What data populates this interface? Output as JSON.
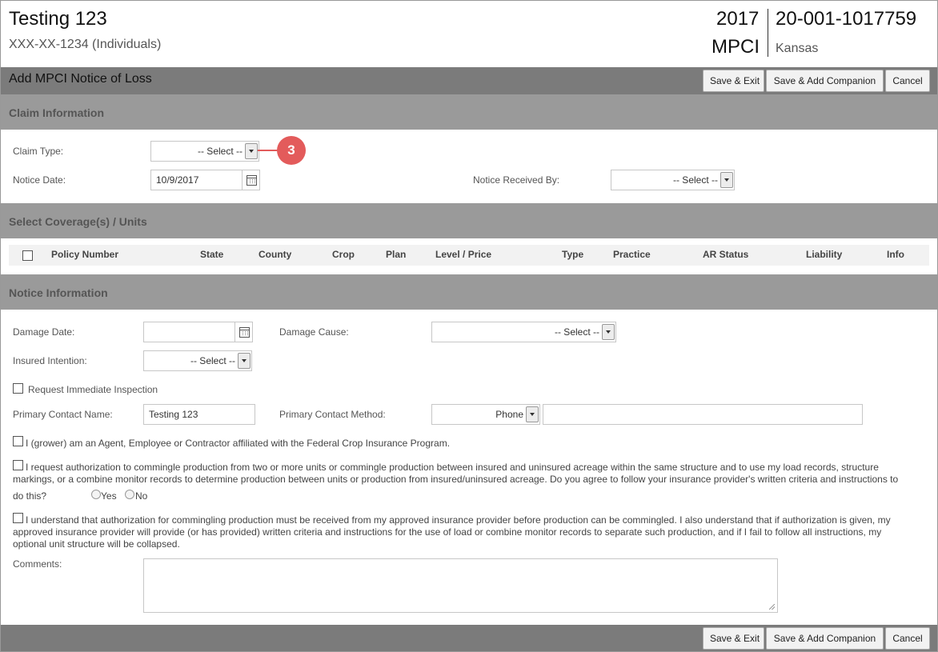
{
  "header": {
    "insured_name": "Testing 123",
    "insured_id": "XXX-XX-1234 (Individuals)",
    "crop_year": "2017",
    "program": "MPCI",
    "policy_number": "20-001-1017759",
    "state": "Kansas"
  },
  "toolbar": {
    "title": "Add MPCI Notice of Loss",
    "save_exit_label": "Save & Exit",
    "save_add_companion_label": "Save & Add Companion",
    "cancel_label": "Cancel"
  },
  "claim_information": {
    "section_title": "Claim Information",
    "claim_type_label": "Claim Type:",
    "claim_type_value": "-- Select --",
    "callout_number": "3",
    "notice_date_label": "Notice Date:",
    "notice_date_value": "10/9/2017",
    "notice_received_by_label": "Notice Received By:",
    "notice_received_by_value": "-- Select --"
  },
  "coverage": {
    "section_title": "Select Coverage(s) / Units",
    "columns": [
      "Policy Number",
      "State",
      "County",
      "Crop",
      "Plan",
      "Level / Price",
      "Type",
      "Practice",
      "AR Status",
      "Liability",
      "Info"
    ]
  },
  "notice_information": {
    "section_title": "Notice Information",
    "damage_date_label": "Damage Date:",
    "damage_date_value": "",
    "damage_cause_label": "Damage Cause:",
    "damage_cause_value": "-- Select --",
    "insured_intention_label": "Insured Intention:",
    "insured_intention_value": "-- Select --",
    "request_inspection_label": "Request Immediate Inspection",
    "primary_contact_name_label": "Primary Contact Name:",
    "primary_contact_name_value": "Testing 123",
    "primary_contact_method_label": "Primary Contact Method:",
    "primary_contact_method_value": "Phone",
    "primary_contact_detail_value": "",
    "affiliation_statement": "I (grower) am an Agent, Employee or Contractor affiliated with the Federal Crop Insurance Program.",
    "commingle_request_line1": "I request authorization to commingle production from two or more units or commingle production between insured and uninsured acreage within the same structure and to use my load records, structure",
    "commingle_request_line2": "markings, or a combine monitor records to determine production between units or production from insured/uninsured acreage. Do you agree to follow your insurance provider's written criteria and instructions to",
    "commingle_request_line3": "do this?",
    "yes_label": "Yes",
    "no_label": "No",
    "understand_line1": "I understand that authorization for commingling production must be received from my approved insurance provider before production can be commingled. I also understand that if authorization is given, my",
    "understand_line2": "approved insurance provider will provide (or has provided) written criteria and instructions for the use of load or combine monitor records to separate such production, and if I fail to follow all instructions, my",
    "understand_line3": "optional unit structure will be collapsed.",
    "comments_label": "Comments:",
    "comments_value": ""
  }
}
